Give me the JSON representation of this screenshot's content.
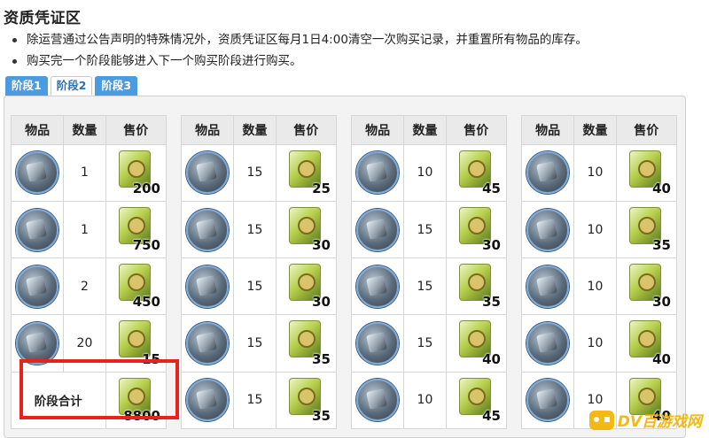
{
  "page": {
    "title": "资质凭证区",
    "bullets": [
      "除运营通过公告声明的特殊情况外，资质凭证区每月1日4:00清空一次购买记录，并重置所有物品的库存。",
      "购买完一个阶段能够进入下一个购买阶段进行购买。"
    ]
  },
  "tabs": [
    {
      "label": "阶段1",
      "active": false
    },
    {
      "label": "阶段2",
      "active": true
    },
    {
      "label": "阶段3",
      "active": false
    }
  ],
  "headers": {
    "item": "物品",
    "qty": "数量",
    "price": "售价"
  },
  "groups": [
    {
      "rows": [
        {
          "icon": "operator-item-icon",
          "qty": "1",
          "price": "200"
        },
        {
          "icon": "operator-item-icon",
          "qty": "1",
          "price": "750"
        },
        {
          "icon": "permit-item-icon",
          "qty": "2",
          "price": "450"
        },
        {
          "icon": "crate-item-icon",
          "qty": "20",
          "price": "15"
        }
      ],
      "total": {
        "label": "阶段合计",
        "price": "8800"
      }
    },
    {
      "rows": [
        {
          "icon": "ore-item-icon",
          "qty": "15",
          "price": "25"
        },
        {
          "icon": "device-item-icon",
          "qty": "15",
          "price": "30"
        },
        {
          "icon": "chip-item-icon",
          "qty": "15",
          "price": "30"
        },
        {
          "icon": "crystal-item-icon",
          "qty": "15",
          "price": "35"
        },
        {
          "icon": "component-item-icon",
          "qty": "15",
          "price": "35"
        }
      ]
    },
    {
      "rows": [
        {
          "icon": "material-item-icon",
          "qty": "10",
          "price": "45"
        },
        {
          "icon": "material-item-icon",
          "qty": "15",
          "price": "30"
        },
        {
          "icon": "material-item-icon",
          "qty": "15",
          "price": "35"
        },
        {
          "icon": "material-item-icon",
          "qty": "15",
          "price": "40"
        },
        {
          "icon": "material-item-icon",
          "qty": "10",
          "price": "45"
        }
      ]
    },
    {
      "rows": [
        {
          "icon": "material-item-icon",
          "qty": "10",
          "price": "40"
        },
        {
          "icon": "material-item-icon",
          "qty": "10",
          "price": "35"
        },
        {
          "icon": "material-item-icon",
          "qty": "10",
          "price": "30"
        },
        {
          "icon": "material-item-icon",
          "qty": "10",
          "price": "40"
        },
        {
          "icon": "material-item-icon",
          "qty": "10",
          "price": "40"
        }
      ]
    }
  ],
  "price_icon": "certificate-icon",
  "watermark": {
    "text": "DV百游戏网"
  },
  "colors": {
    "tab_active_text": "#2a6fb5",
    "tab_bg": "#4b9be0",
    "highlight": "#e8231b",
    "watermark": "#f5b400"
  }
}
